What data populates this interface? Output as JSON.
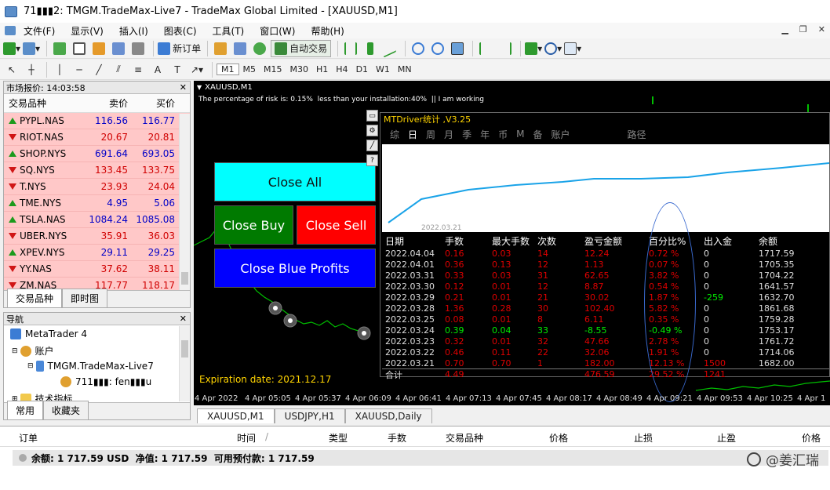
{
  "window": {
    "title": "71▮▮▮2: TMGM.TradeMax-Live7 - TradeMax Global Limited - [XAUUSD,M1]"
  },
  "menu": [
    "文件(F)",
    "显示(V)",
    "插入(I)",
    "图表(C)",
    "工具(T)",
    "窗口(W)",
    "帮助(H)"
  ],
  "toolbar": {
    "new_order": "新订单",
    "auto_trade": "自动交易"
  },
  "timeframes": [
    "M1",
    "M5",
    "M15",
    "M30",
    "H1",
    "H4",
    "D1",
    "W1",
    "MN"
  ],
  "active_timeframe": "M1",
  "market_watch": {
    "title": "市场报价: 14:03:58",
    "cols": {
      "symbol": "交易品种",
      "bid": "卖价",
      "ask": "买价"
    },
    "rows": [
      {
        "symbol": "PYPL.NAS",
        "bid": "116.56",
        "ask": "116.77",
        "dir": "up",
        "color": "blue"
      },
      {
        "symbol": "RIOT.NAS",
        "bid": "20.67",
        "ask": "20.81",
        "dir": "down",
        "color": "red"
      },
      {
        "symbol": "SHOP.NYS",
        "bid": "691.64",
        "ask": "693.05",
        "dir": "up",
        "color": "blue"
      },
      {
        "symbol": "SQ.NYS",
        "bid": "133.45",
        "ask": "133.75",
        "dir": "down",
        "color": "red"
      },
      {
        "symbol": "T.NYS",
        "bid": "23.93",
        "ask": "24.04",
        "dir": "down",
        "color": "red"
      },
      {
        "symbol": "TME.NYS",
        "bid": "4.95",
        "ask": "5.06",
        "dir": "up",
        "color": "blue"
      },
      {
        "symbol": "TSLA.NAS",
        "bid": "1084.24",
        "ask": "1085.08",
        "dir": "up",
        "color": "blue"
      },
      {
        "symbol": "UBER.NYS",
        "bid": "35.91",
        "ask": "36.03",
        "dir": "down",
        "color": "red"
      },
      {
        "symbol": "XPEV.NYS",
        "bid": "29.11",
        "ask": "29.25",
        "dir": "up",
        "color": "blue"
      },
      {
        "symbol": "YY.NAS",
        "bid": "37.62",
        "ask": "38.11",
        "dir": "down",
        "color": "red"
      },
      {
        "symbol": "ZM.NAS",
        "bid": "117.77",
        "ask": "118.17",
        "dir": "down",
        "color": "red"
      }
    ],
    "tabs": [
      "交易品种",
      "即时图"
    ]
  },
  "navigator": {
    "title": "导航",
    "root": "MetaTrader 4",
    "accounts": "账户",
    "server": "TMGM.TradeMax-Live7",
    "account_entry": "711▮▮▮: fen▮▮▮u",
    "indicators": "技术指标",
    "tabs": [
      "常用",
      "收藏夹"
    ]
  },
  "chart": {
    "symbol_label": "XAUUSD,M1",
    "risk_note": "The percentage of risk is: 0.15%  less than your installation:40%  || I am working",
    "expiration": "Expiration date: 2021.12.17",
    "close_all": "Close All",
    "close_buy": "Close Buy",
    "close_sell": "Close Sell",
    "close_blue": "Close Blue Profits",
    "time_axis": [
      "4 Apr 2022",
      "4 Apr 05:05",
      "4 Apr 05:37",
      "4 Apr 06:09",
      "4 Apr 06:41",
      "4 Apr 07:13",
      "4 Apr 07:45",
      "4 Apr 08:17",
      "4 Apr 08:49",
      "4 Apr 09:21",
      "4 Apr 09:53",
      "4 Apr 10:25",
      "4 Apr 1"
    ],
    "tabs": [
      "XAUUSD,M1",
      "USDJPY,H1",
      "XAUUSD,Daily"
    ]
  },
  "stats": {
    "title": "MTDriver统计 ,V3.25",
    "tabs": [
      "综",
      "日",
      "周",
      "月",
      "季",
      "年",
      "币",
      "M",
      "备",
      "账户",
      "路径"
    ],
    "selected_tab": "日",
    "curve_label": "2022.03.21",
    "headers": [
      "日期",
      "手数",
      "最大手数",
      "次数",
      "盈亏金额",
      "百分比%",
      "出入金",
      "余额"
    ],
    "rows": [
      [
        "2022.04.04",
        "0.16",
        "0.03",
        "14",
        "12.24",
        "0.72 %",
        "0",
        "1717.59",
        "r"
      ],
      [
        "2022.04.01",
        "0.36",
        "0.13",
        "12",
        "1.13",
        "0.07 %",
        "0",
        "1705.35",
        "r"
      ],
      [
        "2022.03.31",
        "0.33",
        "0.03",
        "31",
        "62.65",
        "3.82 %",
        "0",
        "1704.22",
        "r"
      ],
      [
        "2022.03.30",
        "0.12",
        "0.01",
        "12",
        "8.87",
        "0.54 %",
        "0",
        "1641.57",
        "r"
      ],
      [
        "2022.03.29",
        "0.21",
        "0.01",
        "21",
        "30.02",
        "1.87 %",
        "-259",
        "1632.70",
        "r"
      ],
      [
        "2022.03.28",
        "1.36",
        "0.28",
        "30",
        "102.40",
        "5.82 %",
        "0",
        "1861.68",
        "r"
      ],
      [
        "2022.03.25",
        "0.08",
        "0.01",
        "8",
        "6.11",
        "0.35 %",
        "0",
        "1759.28",
        "r"
      ],
      [
        "2022.03.24",
        "0.39",
        "0.04",
        "33",
        "-8.55",
        "-0.49 %",
        "0",
        "1753.17",
        "g"
      ],
      [
        "2022.03.23",
        "0.32",
        "0.01",
        "32",
        "47.66",
        "2.78 %",
        "0",
        "1761.72",
        "r"
      ],
      [
        "2022.03.22",
        "0.46",
        "0.11",
        "22",
        "32.06",
        "1.91 %",
        "0",
        "1714.06",
        "r"
      ],
      [
        "2022.03.21",
        "0.70",
        "0.70",
        "1",
        "182.00",
        "12.13 %",
        "1500",
        "1682.00",
        "r"
      ]
    ],
    "total": [
      "合计",
      "4.49",
      "",
      "",
      "476.59",
      "29.52 %",
      "1241",
      ""
    ]
  },
  "terminal": {
    "headers": [
      "订单",
      "时间",
      "类型",
      "手数",
      "交易品种",
      "价格",
      "止损",
      "止盈",
      "价格"
    ],
    "balance_line": "余额: 1 717.59 USD  净值: 1 717.59  可用预付款: 1 717.59"
  },
  "watermark": "@姜汇瑞"
}
